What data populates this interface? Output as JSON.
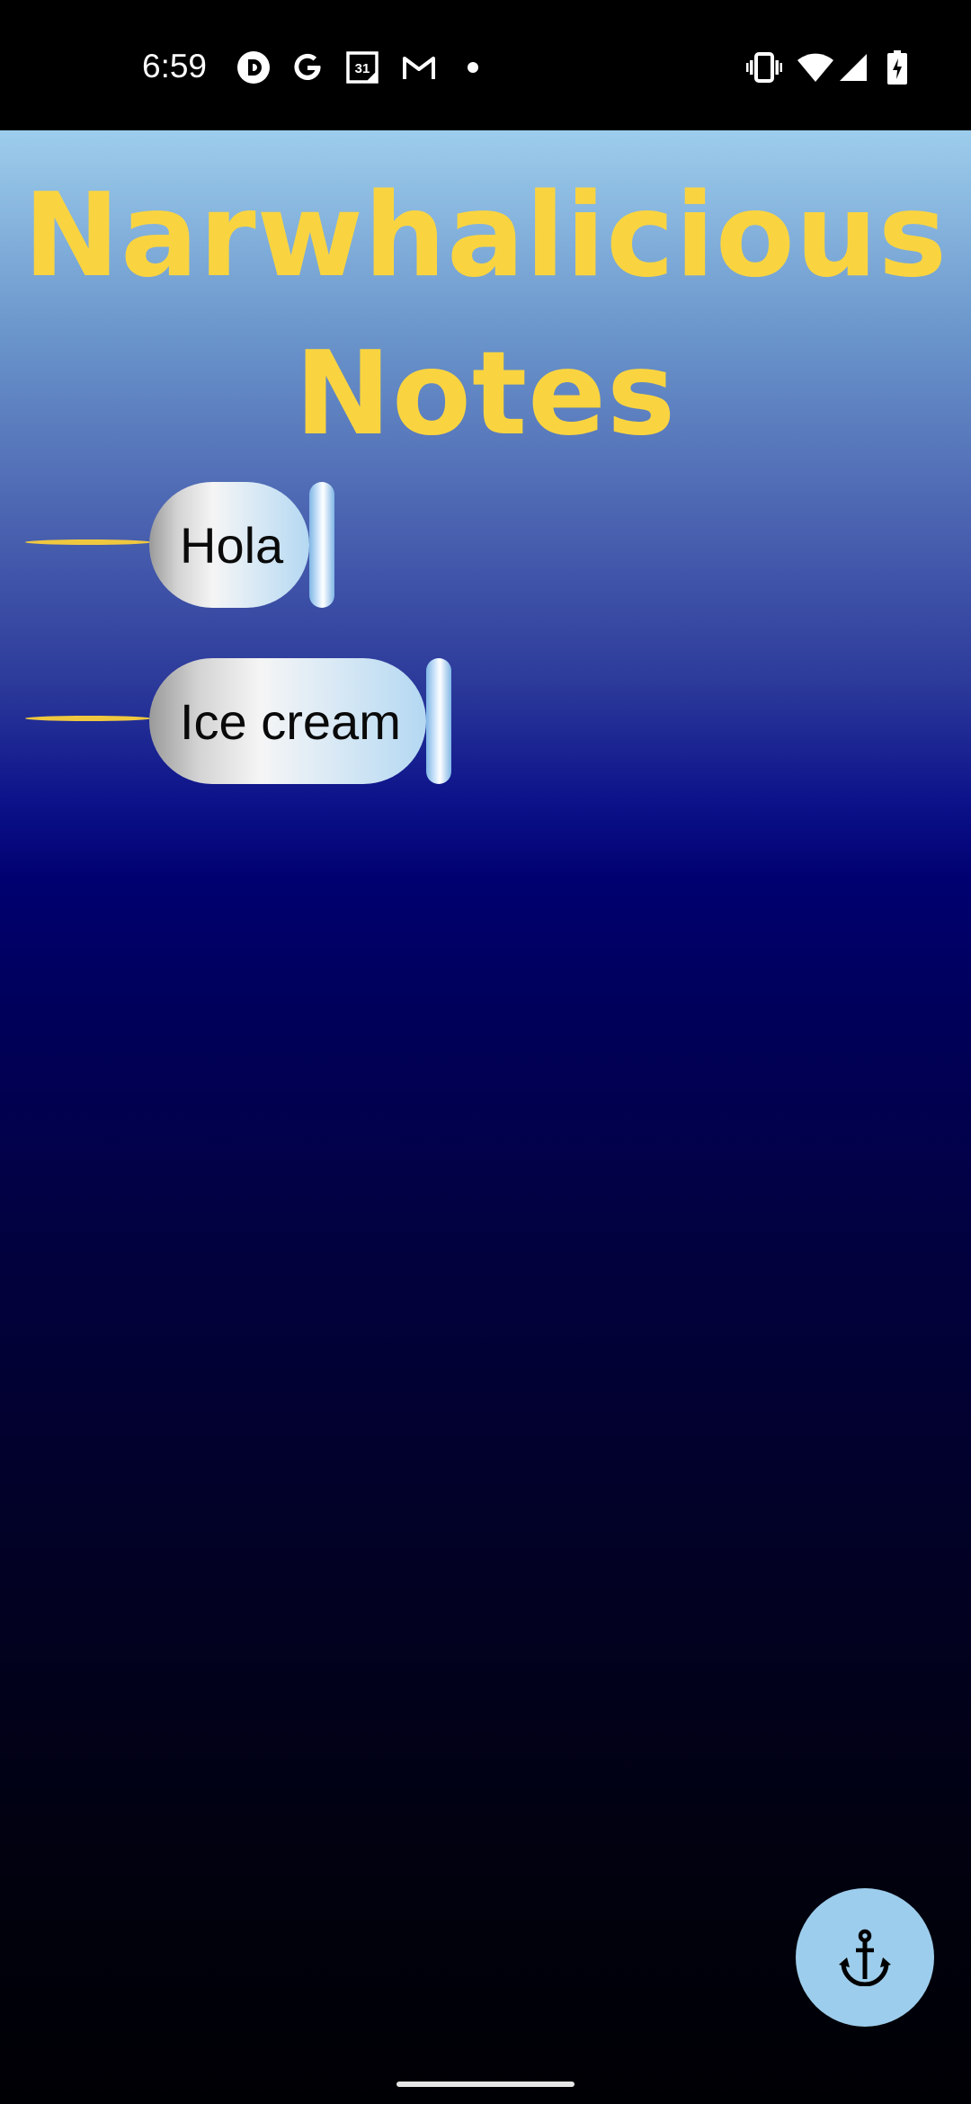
{
  "status_bar": {
    "time": "6:59",
    "left_icons": [
      "pocket-casts-icon",
      "google-icon",
      "calendar-icon",
      "gmail-icon",
      "dot-icon"
    ],
    "calendar_day": "31",
    "right_icons": [
      "vibrate-icon",
      "wifi-icon",
      "signal-icon",
      "battery-charging-icon"
    ]
  },
  "app": {
    "title_line1": "Narwhalicious",
    "title_line2": "Notes",
    "title_color": "#fad440"
  },
  "notes": [
    {
      "label": "Hola"
    },
    {
      "label": "Ice cream"
    }
  ],
  "fab": {
    "icon": "anchor-icon",
    "color": "#9dcdec"
  }
}
